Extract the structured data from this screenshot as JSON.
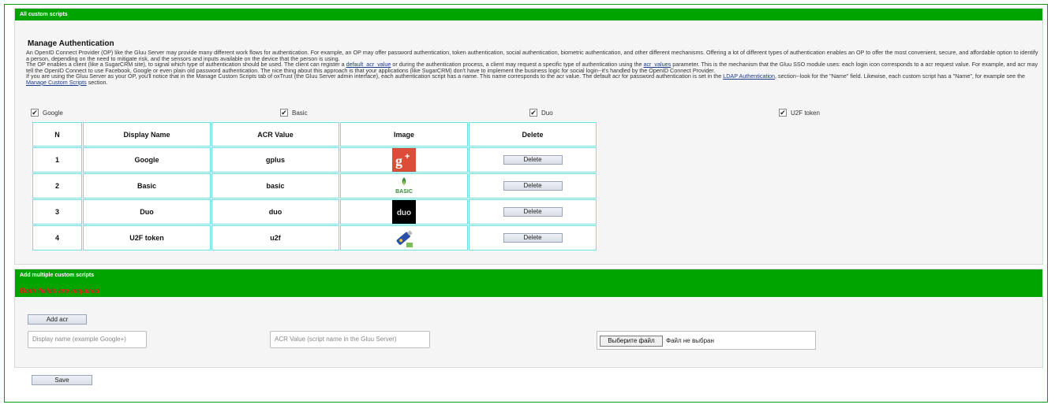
{
  "panel1": {
    "header": "All custom scripts",
    "title": "Manage Authentication",
    "desc": {
      "p1": "An OpenID Connect Provider (OP) like the Gluu Server may provide many different work flows for authentication. For example, an OP may offer password authentication, token authentication, social authentication, biometric authentication, and other different mechanisms. Offering a lot of different types of authentication enables an OP to offer the most convenient, secure, and affordable option to identify a person, depending on the need to mitigate risk, and the sensors and inputs available on the device that the person is using.",
      "p2a": "The OP enables a client (like a SugarCRM site), to signal which type of authentication should be used. The client can register a ",
      "link1": "default_acr_value",
      "p2b": " or during the authentication process, a client may request a specific type of authentication using the ",
      "link2": "acr_values",
      "p2c": " parameter. This is the mechanism that the Gluu SSO module uses: each login icon corresponds to a acr request value. For example, and acr may tell the OpenID Connect to use Facebook, Google or even plain old password authentication. The nice thing about this approach is that your applications (like SugarCRM) don't have to implement the business logic for social login--it's handled by the OpenID Connect Provider.",
      "p3a": "If you are using the Gluu Server as your OP, you'll notice that in the Manage Custom Scripts tab of oxTrust (the Gluu Server admin interface), each authentication script has a name. This name corresponds to the acr value. The default acr for password authentication is set in the ",
      "link3": "LDAP Authentication",
      "p3b": ", section--look for the \"Name\" field. Likewise, each custom script has a \"Name\", for example see the ",
      "link4": "Manage Custom Scripts",
      "p3c": " section."
    },
    "checkboxes": [
      {
        "label": "Google",
        "checked": true
      },
      {
        "label": "Basic",
        "checked": true
      },
      {
        "label": "Duo",
        "checked": true
      },
      {
        "label": "U2F token",
        "checked": true
      }
    ],
    "table": {
      "headers": [
        "N",
        "Display Name",
        "ACR Value",
        "Image",
        "Delete"
      ],
      "rows": [
        {
          "n": "1",
          "name": "Google",
          "acr": "gplus",
          "image": "google-plus-icon",
          "delete": "Delete"
        },
        {
          "n": "2",
          "name": "Basic",
          "acr": "basic",
          "image": "basic-icon",
          "delete": "Delete"
        },
        {
          "n": "3",
          "name": "Duo",
          "acr": "duo",
          "image": "duo-icon",
          "delete": "Delete"
        },
        {
          "n": "4",
          "name": "U2F token",
          "acr": "u2f",
          "image": "u2f-key-icon",
          "delete": "Delete"
        }
      ]
    }
  },
  "panel2": {
    "header": "Add multiple custom scripts",
    "error": "Both fields are required",
    "add_acr_label": "Add acr",
    "display_name_placeholder": "Display name (example Google+)",
    "acr_value_placeholder": "ACR Value (script name in the Gluu Server)",
    "file_button": "Выберите файл",
    "file_status": "Файл не выбран"
  },
  "save_label": "Save",
  "colors": {
    "header_green": "#00a400",
    "border_green": "#0b9b0b",
    "table_border": "#6be0e0",
    "error_red": "#d32020",
    "google_red": "#dd4b39"
  }
}
